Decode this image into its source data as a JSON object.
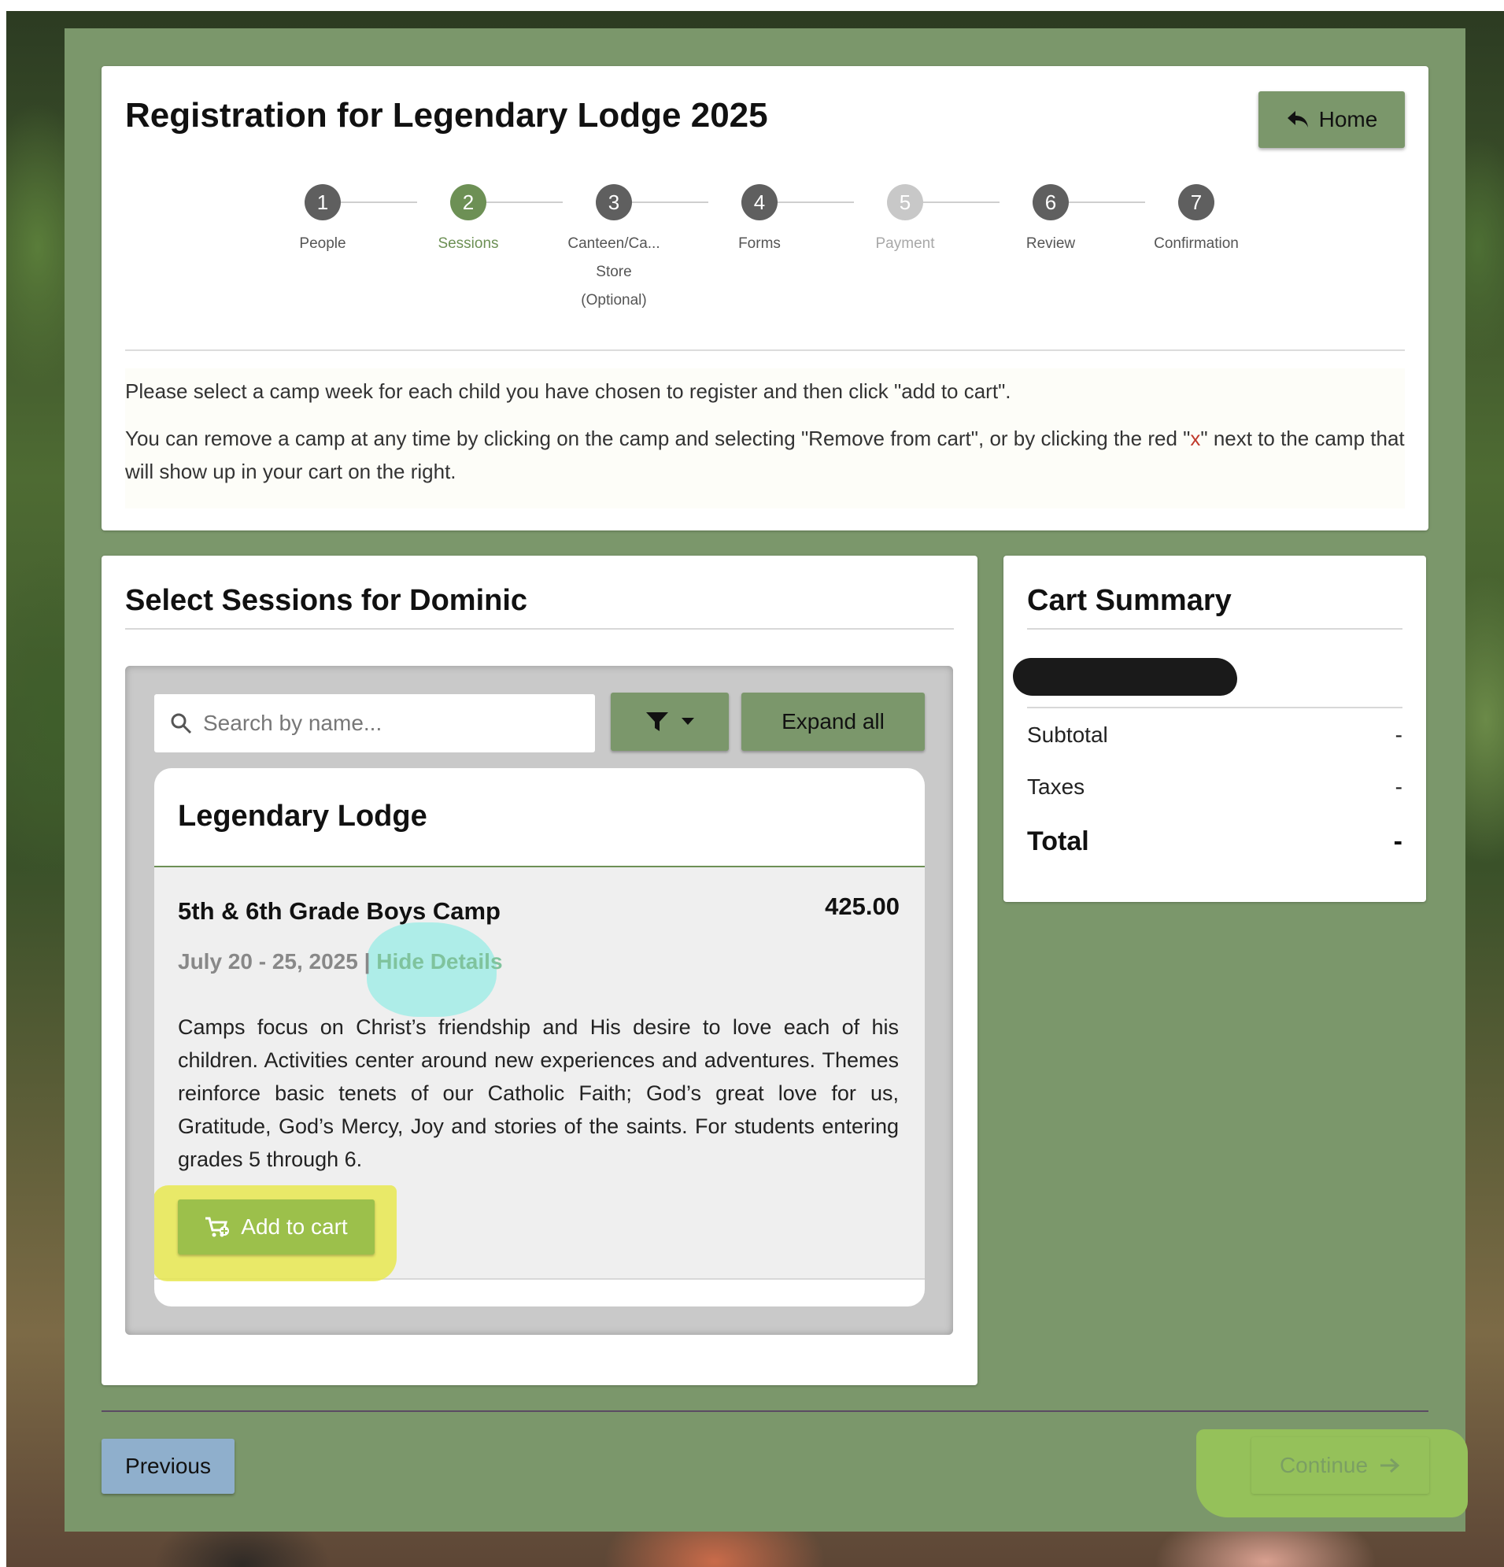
{
  "header": {
    "title": "Registration for Legendary Lodge 2025",
    "home_label": "Home"
  },
  "steps": [
    {
      "num": "1",
      "label": "People",
      "state": "default"
    },
    {
      "num": "2",
      "label": "Sessions",
      "state": "active"
    },
    {
      "num": "3",
      "label_lines": [
        "Canteen/Ca...",
        "Store",
        "(Optional)"
      ],
      "state": "default"
    },
    {
      "num": "4",
      "label": "Forms",
      "state": "default"
    },
    {
      "num": "5",
      "label": "Payment",
      "state": "disabled"
    },
    {
      "num": "6",
      "label": "Review",
      "state": "default"
    },
    {
      "num": "7",
      "label": "Confirmation",
      "state": "default"
    }
  ],
  "instructions": {
    "line1": "Please select a camp week for each child you have chosen to register and then click \"add to cart\".",
    "line2_before": "You can remove a camp at any time by clicking on the camp and selecting \"Remove from cart\", or by clicking the red \"",
    "line2_x": "x",
    "line2_after": "\" next to the camp that will show up in your cart on the right."
  },
  "sessions": {
    "title": "Select Sessions for Dominic",
    "search_placeholder": "Search by name...",
    "expand_label": "Expand all",
    "group_title": "Legendary Lodge",
    "session": {
      "name": "5th & 6th Grade Boys Camp",
      "price": "425.00",
      "dates": "July 20 - 25, 2025 |",
      "details_toggle": "Hide Details",
      "description": "Camps focus on Christ’s friendship and His desire to love each of his children. Activities center around new experiences and adventures. Themes reinforce basic tenets of our Catholic Faith; God’s great love for us, Gratitude, God’s Mercy, Joy and stories of the saints. For students entering grades 5 through 6.",
      "add_label": "Add to cart"
    }
  },
  "cart": {
    "title": "Cart Summary",
    "subtotal_label": "Subtotal",
    "subtotal_value": "-",
    "taxes_label": "Taxes",
    "taxes_value": "-",
    "total_label": "Total",
    "total_value": "-"
  },
  "footer": {
    "previous_label": "Previous",
    "continue_label": "Continue"
  },
  "colors": {
    "brand_green": "#7b976b",
    "active_step": "#6d9055",
    "add_button": "#9cc04b",
    "previous_button": "#8fafcc"
  }
}
